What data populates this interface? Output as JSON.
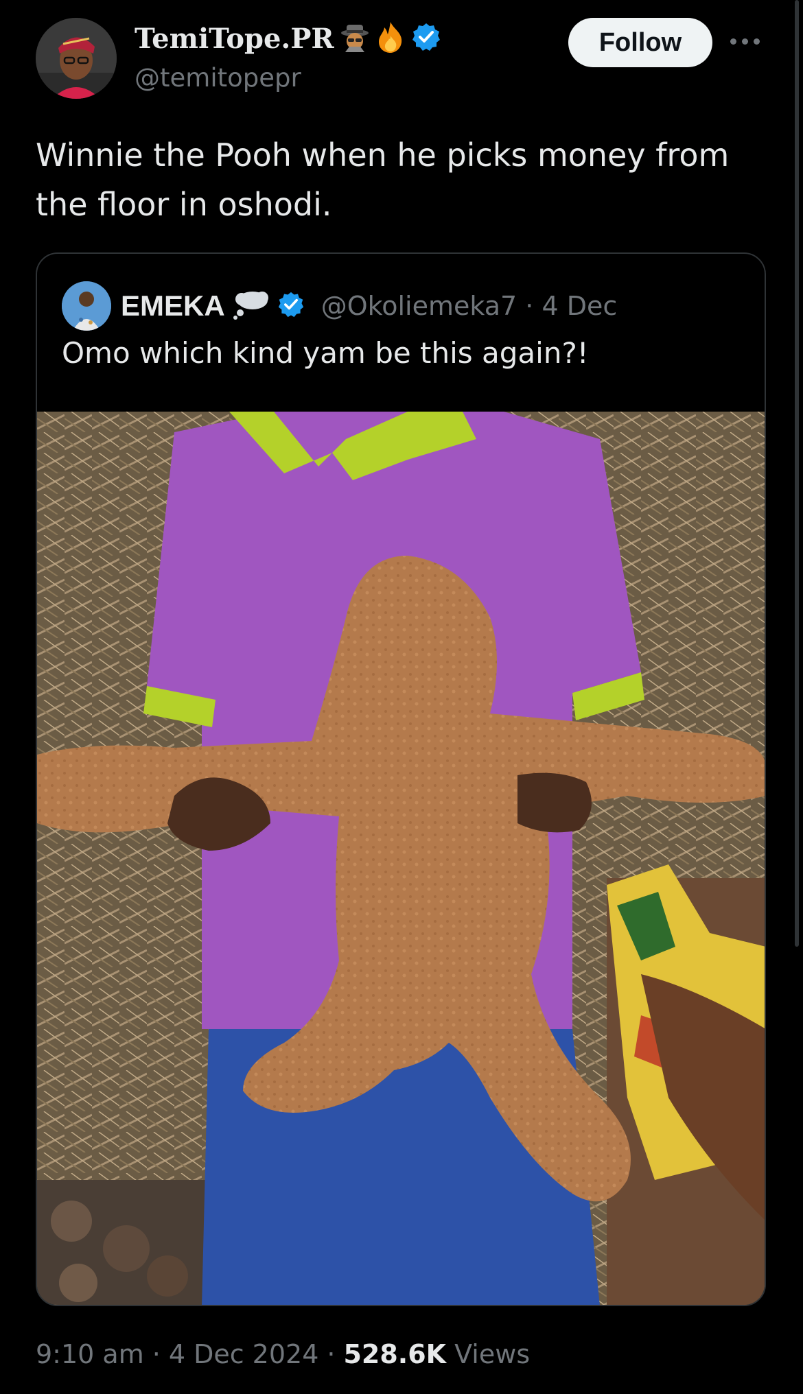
{
  "author": {
    "display_name": "TemiTope.PR",
    "handle": "@temitopepr",
    "verified_color": "#1d9bf0"
  },
  "follow_label": "Follow",
  "tweet_text": "Winnie the Pooh when he picks money from the floor in oshodi.",
  "quote": {
    "display_name": "EMEKA",
    "handle": "@Okoliemeka7",
    "separator": "·",
    "date": "4 Dec",
    "text": "Omo which kind yam be this again?!"
  },
  "footer": {
    "time": "9:10 am",
    "sep1": "·",
    "date": "4 Dec 2024",
    "sep2": "·",
    "views_count": "528.6K",
    "views_label": "Views"
  },
  "colors": {
    "background": "#000000",
    "text": "#e7e9ea",
    "muted": "#71767b",
    "border": "#2f3336",
    "accent": "#1d9bf0"
  },
  "icons": [
    "spy-emoji-icon",
    "fire-emoji-icon",
    "verified-badge-icon",
    "more-options-icon",
    "thought-bubble-icon"
  ]
}
